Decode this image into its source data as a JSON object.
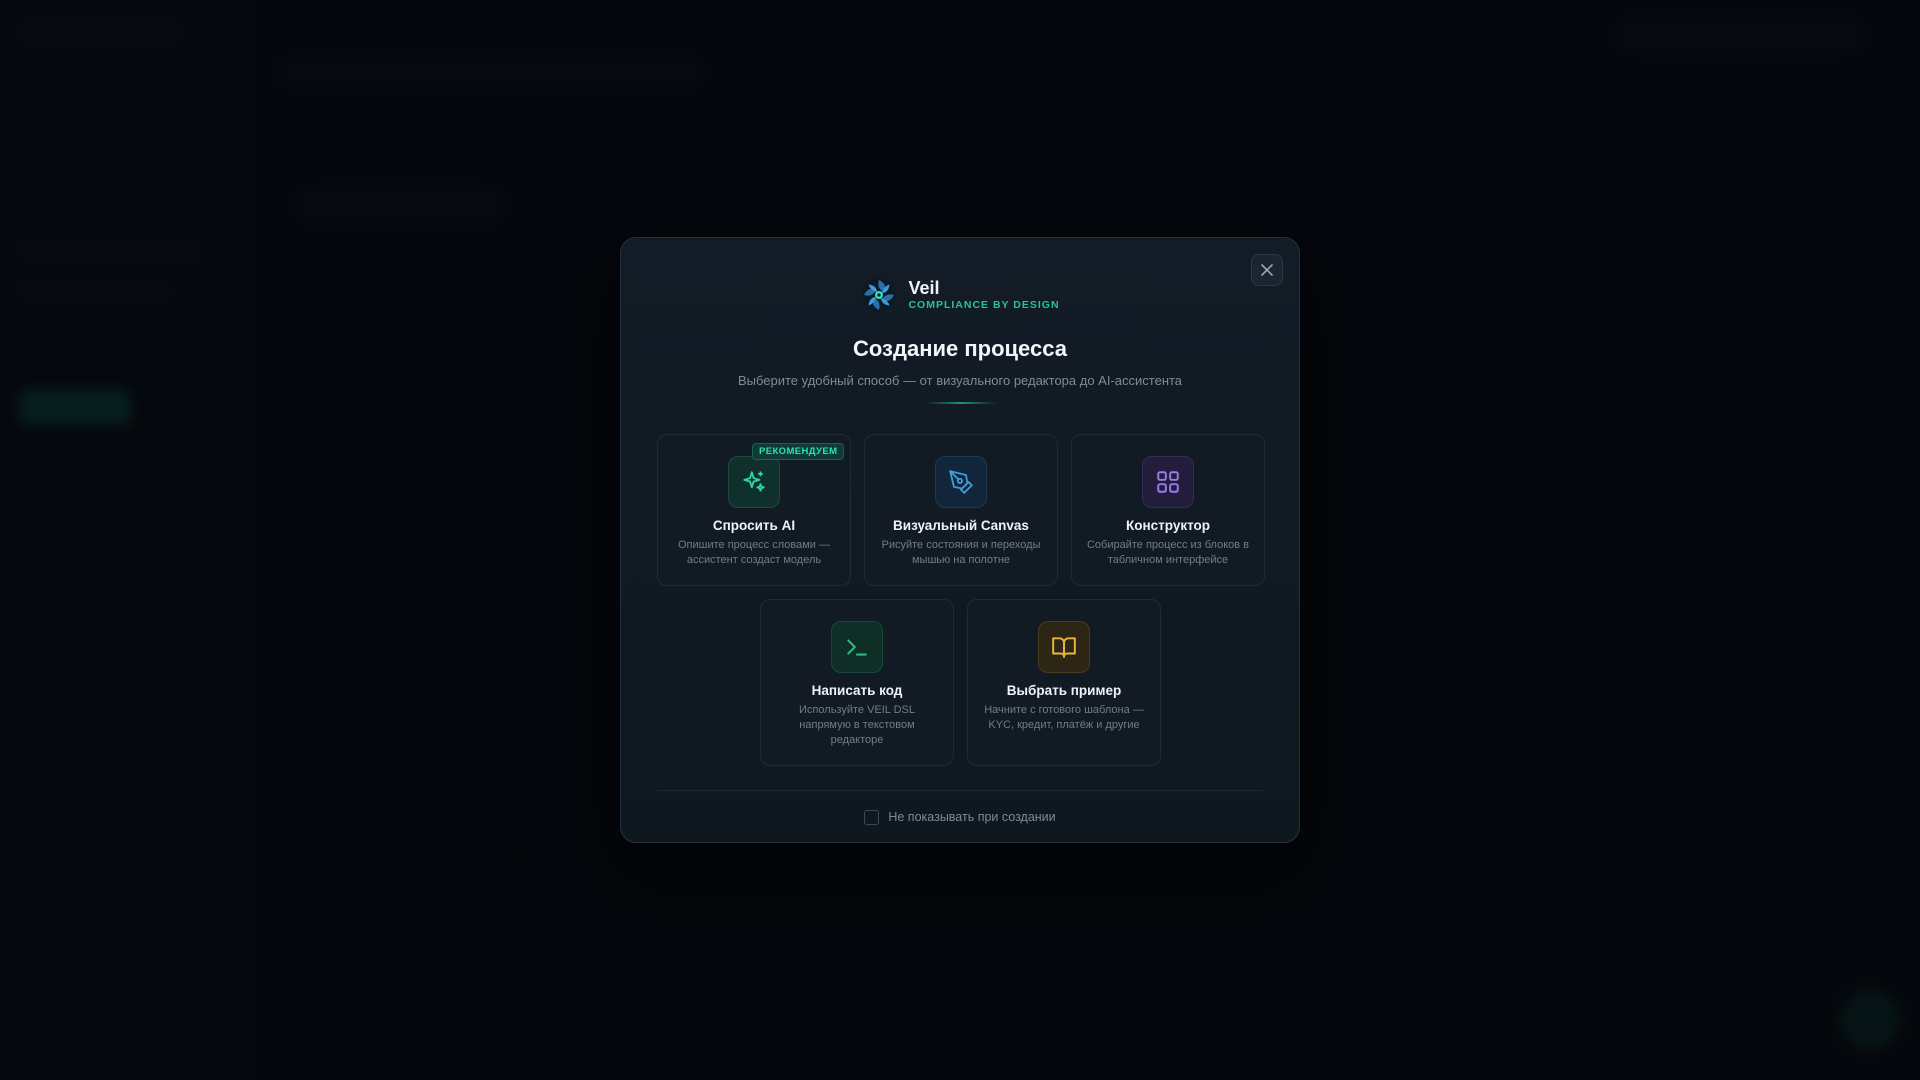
{
  "brand": {
    "name": "Veil",
    "tagline": "COMPLIANCE BY DESIGN"
  },
  "dialog": {
    "title": "Создание процесса",
    "subtitle": "Выберите удобный способ — от визуального редактора до AI-ассистента",
    "close_icon": "close-icon"
  },
  "options": [
    {
      "title": "Спросить AI",
      "description": "Опишите процесс словами — ассистент создаст модель",
      "badge": "РЕКОМЕНДУЕМ",
      "icon": "sparkles-icon",
      "color": "#2fd1a6"
    },
    {
      "title": "Визуальный Canvas",
      "description": "Рисуйте состояния и переходы мышью на полотне",
      "icon": "pen-tool-icon",
      "color": "#3f9bd8"
    },
    {
      "title": "Конструктор",
      "description": "Собирайте процесс из блоков в табличном интерфейсе",
      "icon": "grid-icon",
      "color": "#9b7bea"
    },
    {
      "title": "Написать код",
      "description": "Используйте VEIL DSL напрямую в текстовом редакторе",
      "icon": "terminal-icon",
      "color": "#2fb886"
    },
    {
      "title": "Выбрать пример",
      "description": "Начните с готового шаблона — KYC, кредит, платёж и другие",
      "icon": "book-icon",
      "color": "#e9b53c"
    }
  ],
  "footer": {
    "checkbox_label": "Не показывать при создании",
    "checked": false
  },
  "colors": {
    "accent": "#27c29b",
    "background": "#070b10",
    "modal": "#131c26"
  }
}
